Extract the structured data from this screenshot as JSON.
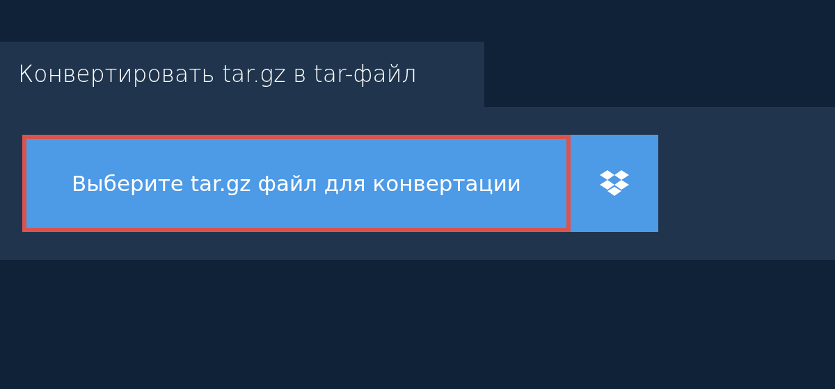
{
  "tab": {
    "title": "Конвертировать tar.gz в tar-файл"
  },
  "upload": {
    "label": "Выберите tar.gz файл для конвертации",
    "highlighted": true
  },
  "cloud_button": {
    "kind": "dropbox"
  }
}
